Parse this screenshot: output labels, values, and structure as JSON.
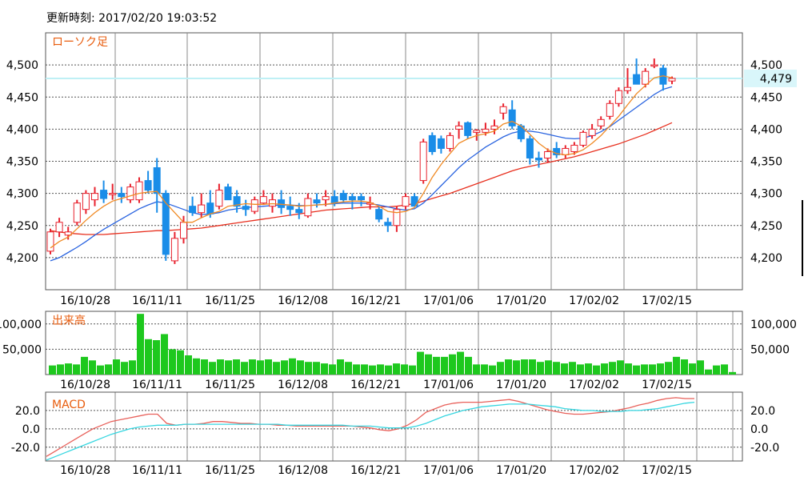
{
  "header": {
    "updated_label": "更新時刻:",
    "updated_time": "2017/02/20 19:03:52"
  },
  "colors": {
    "up": "#e8212d",
    "down": "#1a8de8",
    "ma_short": "#f08a24",
    "ma_mid": "#2a64e0",
    "ma_long": "#e8301f",
    "volume": "#1ec81e",
    "macd": "#e8605a",
    "signal": "#36d6e0",
    "grid": "#555555",
    "last_line": "#bff0f5"
  },
  "chart_data": [
    {
      "type": "candlestick",
      "title": "ローソク足",
      "x_labels": [
        "16/10/28",
        "16/11/11",
        "16/11/25",
        "16/12/08",
        "16/12/21",
        "17/01/06",
        "17/01/20",
        "17/02/02",
        "17/02/15"
      ],
      "x_label_indices": [
        1,
        10,
        19,
        28,
        37,
        46,
        55,
        64,
        73
      ],
      "y_ticks": [
        4200,
        4250,
        4300,
        4350,
        4400,
        4450,
        4500
      ],
      "y_tick_labels": [
        "4,200",
        "4,250",
        "4,300",
        "4,350",
        "4,400",
        "4,450",
        "4,500"
      ],
      "ylim": [
        4150,
        4550
      ],
      "last_value": 4479,
      "last_value_label": "4,479",
      "ohlc": [
        [
          4210,
          4245,
          4205,
          4240
        ],
        [
          4240,
          4262,
          4232,
          4255
        ],
        [
          4235,
          4248,
          4228,
          4240
        ],
        [
          4255,
          4290,
          4250,
          4285
        ],
        [
          4275,
          4305,
          4268,
          4300
        ],
        [
          4290,
          4310,
          4280,
          4300
        ],
        [
          4305,
          4320,
          4285,
          4292
        ],
        [
          4298,
          4315,
          4290,
          4300
        ],
        [
          4300,
          4310,
          4285,
          4295
        ],
        [
          4290,
          4315,
          4285,
          4310
        ],
        [
          4290,
          4325,
          4285,
          4318
        ],
        [
          4320,
          4335,
          4300,
          4305
        ],
        [
          4340,
          4355,
          4270,
          4300
        ],
        [
          4300,
          4305,
          4195,
          4205
        ],
        [
          4195,
          4240,
          4190,
          4230
        ],
        [
          4230,
          4265,
          4222,
          4255
        ],
        [
          4280,
          4295,
          4265,
          4270
        ],
        [
          4270,
          4300,
          4262,
          4282
        ],
        [
          4285,
          4305,
          4262,
          4268
        ],
        [
          4280,
          4315,
          4275,
          4305
        ],
        [
          4310,
          4315,
          4290,
          4290
        ],
        [
          4295,
          4305,
          4270,
          4280
        ],
        [
          4280,
          4290,
          4265,
          4275
        ],
        [
          4272,
          4295,
          4268,
          4290
        ],
        [
          4285,
          4305,
          4282,
          4295
        ],
        [
          4280,
          4300,
          4270,
          4290
        ],
        [
          4290,
          4305,
          4268,
          4278
        ],
        [
          4280,
          4295,
          4265,
          4275
        ],
        [
          4275,
          4285,
          4260,
          4270
        ],
        [
          4265,
          4300,
          4262,
          4292
        ],
        [
          4290,
          4300,
          4278,
          4285
        ],
        [
          4290,
          4305,
          4280,
          4295
        ],
        [
          4295,
          4305,
          4280,
          4285
        ],
        [
          4300,
          4305,
          4285,
          4290
        ],
        [
          4295,
          4300,
          4275,
          4290
        ],
        [
          4295,
          4300,
          4280,
          4290
        ],
        [
          4285,
          4295,
          4275,
          4285
        ],
        [
          4275,
          4280,
          4255,
          4260
        ],
        [
          4255,
          4262,
          4240,
          4250
        ],
        [
          4250,
          4280,
          4240,
          4275
        ],
        [
          4280,
          4300,
          4275,
          4295
        ],
        [
          4295,
          4300,
          4280,
          4280
        ],
        [
          4320,
          4385,
          4315,
          4380
        ],
        [
          4390,
          4395,
          4360,
          4365
        ],
        [
          4385,
          4390,
          4362,
          4370
        ],
        [
          4370,
          4395,
          4365,
          4390
        ],
        [
          4400,
          4412,
          4385,
          4405
        ],
        [
          4410,
          4412,
          4385,
          4390
        ],
        [
          4395,
          4400,
          4382,
          4398
        ],
        [
          4395,
          4410,
          4390,
          4400
        ],
        [
          4400,
          4415,
          4392,
          4405
        ],
        [
          4425,
          4440,
          4415,
          4435
        ],
        [
          4430,
          4445,
          4400,
          4405
        ],
        [
          4405,
          4408,
          4380,
          4385
        ],
        [
          4385,
          4390,
          4345,
          4355
        ],
        [
          4355,
          4365,
          4340,
          4352
        ],
        [
          4355,
          4370,
          4348,
          4365
        ],
        [
          4370,
          4380,
          4355,
          4360
        ],
        [
          4360,
          4375,
          4355,
          4370
        ],
        [
          4365,
          4380,
          4360,
          4375
        ],
        [
          4375,
          4398,
          4372,
          4395
        ],
        [
          4390,
          4408,
          4385,
          4400
        ],
        [
          4405,
          4420,
          4400,
          4415
        ],
        [
          4420,
          4445,
          4415,
          4440
        ],
        [
          4440,
          4465,
          4435,
          4460
        ],
        [
          4460,
          4495,
          4455,
          4465
        ],
        [
          4485,
          4510,
          4480,
          4470
        ],
        [
          4470,
          4495,
          4465,
          4490
        ],
        [
          4500,
          4510,
          4495,
          4500
        ],
        [
          4495,
          4500,
          4460,
          4470
        ],
        [
          4475,
          4482,
          4470,
          4479
        ]
      ],
      "ma_short": [
        4215,
        4225,
        4232,
        4245,
        4258,
        4270,
        4280,
        4288,
        4292,
        4296,
        4300,
        4302,
        4303,
        4285,
        4270,
        4255,
        4255,
        4262,
        4268,
        4272,
        4280,
        4282,
        4284,
        4283,
        4283,
        4284,
        4283,
        4282,
        4280,
        4281,
        4282,
        4283,
        4285,
        4287,
        4288,
        4288,
        4286,
        4280,
        4272,
        4270,
        4272,
        4278,
        4300,
        4325,
        4345,
        4362,
        4378,
        4385,
        4390,
        4393,
        4397,
        4408,
        4412,
        4405,
        4392,
        4378,
        4368,
        4362,
        4360,
        4362,
        4368,
        4378,
        4390,
        4405,
        4420,
        4438,
        4455,
        4468,
        4480,
        4483,
        4480
      ],
      "ma_mid": [
        4195,
        4200,
        4208,
        4216,
        4225,
        4235,
        4244,
        4252,
        4260,
        4268,
        4276,
        4282,
        4287,
        4285,
        4280,
        4275,
        4270,
        4267,
        4268,
        4270,
        4274,
        4276,
        4278,
        4279,
        4280,
        4281,
        4282,
        4282,
        4281,
        4281,
        4282,
        4283,
        4284,
        4285,
        4285,
        4285,
        4284,
        4282,
        4279,
        4276,
        4274,
        4276,
        4285,
        4298,
        4312,
        4326,
        4340,
        4352,
        4362,
        4372,
        4380,
        4388,
        4394,
        4397,
        4397,
        4395,
        4392,
        4389,
        4386,
        4385,
        4386,
        4390,
        4396,
        4404,
        4414,
        4424,
        4434,
        4444,
        4454,
        4462,
        4466
      ],
      "ma_long": [
        4242,
        4240,
        4238,
        4237,
        4236,
        4236,
        4236,
        4237,
        4238,
        4239,
        4240,
        4241,
        4242,
        4242,
        4243,
        4244,
        4245,
        4246,
        4248,
        4250,
        4252,
        4254,
        4256,
        4258,
        4260,
        4262,
        4264,
        4266,
        4268,
        4270,
        4272,
        4274,
        4275,
        4276,
        4277,
        4278,
        4279,
        4279,
        4279,
        4280,
        4282,
        4284,
        4288,
        4292,
        4296,
        4300,
        4305,
        4310,
        4315,
        4320,
        4325,
        4330,
        4335,
        4339,
        4342,
        4345,
        4348,
        4351,
        4354,
        4357,
        4361,
        4365,
        4369,
        4373,
        4377,
        4382,
        4387,
        4392,
        4398,
        4404,
        4410
      ]
    },
    {
      "type": "bar",
      "title": "出来高",
      "y_ticks": [
        50000,
        100000
      ],
      "y_tick_labels": [
        "50,000",
        "100,000"
      ],
      "ylim": [
        0,
        125000
      ],
      "values": [
        18000,
        20000,
        22000,
        20000,
        35000,
        28000,
        18000,
        20000,
        30000,
        25000,
        28000,
        120000,
        70000,
        68000,
        80000,
        50000,
        48000,
        38000,
        32000,
        30000,
        25000,
        30000,
        28000,
        30000,
        25000,
        30000,
        28000,
        30000,
        25000,
        28000,
        32000,
        28000,
        25000,
        25000,
        22000,
        20000,
        30000,
        25000,
        20000,
        20000,
        18000,
        20000,
        18000,
        22000,
        20000,
        18000,
        45000,
        40000,
        35000,
        35000,
        40000,
        45000,
        35000,
        20000,
        20000,
        18000,
        25000,
        30000,
        28000,
        30000,
        30000,
        25000,
        28000,
        25000,
        22000,
        25000,
        20000,
        22000,
        18000,
        22000,
        25000,
        28000,
        22000,
        18000,
        20000,
        20000,
        22000,
        25000,
        35000,
        30000,
        22000,
        28000,
        10000,
        18000,
        20000,
        5000
      ]
    },
    {
      "type": "line",
      "title": "MACD",
      "y_ticks": [
        -20,
        0,
        20
      ],
      "y_tick_labels": [
        "-20.0",
        "0.0",
        "20.0"
      ],
      "ylim": [
        -35,
        40
      ],
      "series": [
        {
          "role": "macd",
          "values": [
            -30,
            -24,
            -18,
            -12,
            -6,
            0,
            4,
            8,
            10,
            12,
            14,
            16,
            16,
            6,
            4,
            5,
            5,
            6,
            8,
            8,
            7,
            6,
            6,
            5,
            5,
            4,
            4,
            3,
            3,
            3,
            3,
            3,
            3,
            3,
            2,
            1,
            -1,
            -2,
            0,
            4,
            10,
            18,
            22,
            26,
            28,
            29,
            29,
            29,
            30,
            31,
            32,
            30,
            27,
            24,
            21,
            19,
            17,
            16,
            16,
            17,
            18,
            19,
            21,
            23,
            26,
            28,
            31,
            33,
            34,
            33,
            33
          ]
        },
        {
          "role": "signal",
          "values": [
            -34,
            -30,
            -26,
            -22,
            -18,
            -14,
            -10,
            -6,
            -3,
            0,
            2,
            3,
            4,
            4,
            4,
            5,
            5,
            5,
            5,
            5,
            5,
            5,
            5,
            5,
            5,
            5,
            4,
            4,
            4,
            4,
            4,
            4,
            4,
            3,
            3,
            3,
            2,
            1,
            1,
            1,
            3,
            6,
            10,
            14,
            17,
            20,
            22,
            24,
            25,
            26,
            27,
            27,
            27,
            26,
            25,
            24,
            22,
            21,
            20,
            20,
            19,
            19,
            19,
            20,
            20,
            21,
            22,
            24,
            26,
            28,
            29
          ]
        }
      ]
    }
  ]
}
